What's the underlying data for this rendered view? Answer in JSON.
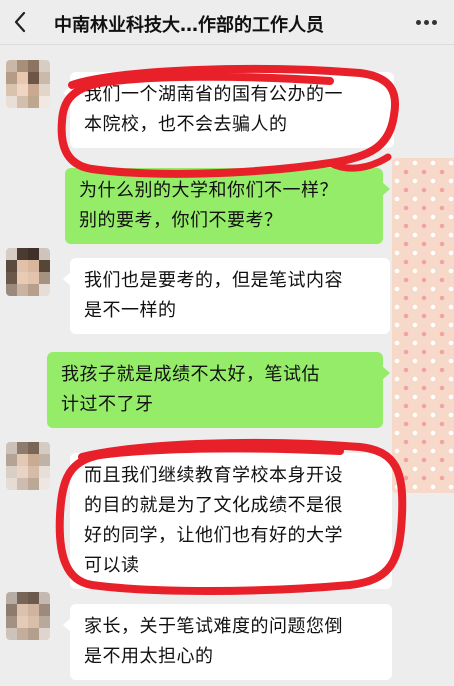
{
  "header": {
    "title": "中南林业科技大…作部的工作人员",
    "back_icon": "chevron-left-icon",
    "more_icon": "more-dots-icon"
  },
  "messages": [
    {
      "side": "left",
      "lines": [
        "我们一个湖南省的国有公办的一",
        "本院校，也不会去骗人的"
      ]
    },
    {
      "side": "right",
      "lines": [
        "为什么别的大学和你们不一样？",
        "别的要考，你们不要考？"
      ]
    },
    {
      "side": "left",
      "lines": [
        "我们也是要考的，但是笔试内容",
        "是不一样的"
      ]
    },
    {
      "side": "right",
      "lines": [
        "我孩子就是成绩不太好，笔试估",
        "计过不了牙"
      ]
    },
    {
      "side": "left",
      "lines": [
        "而且我们继续教育学校本身开设",
        "的目的就是为了文化成绩不是很",
        "好的同学，让他们也有好的大学",
        "可以读"
      ]
    },
    {
      "side": "left",
      "lines": [
        "家长，关于笔试难度的问题您倒",
        "是不用太担心的"
      ]
    }
  ],
  "colors": {
    "chat_background": "#ededed",
    "incoming_bubble": "#ffffff",
    "outgoing_bubble": "#95ec69",
    "annotation_red": "#e8202a",
    "self_avatar_pattern": "#f7d9c9"
  }
}
